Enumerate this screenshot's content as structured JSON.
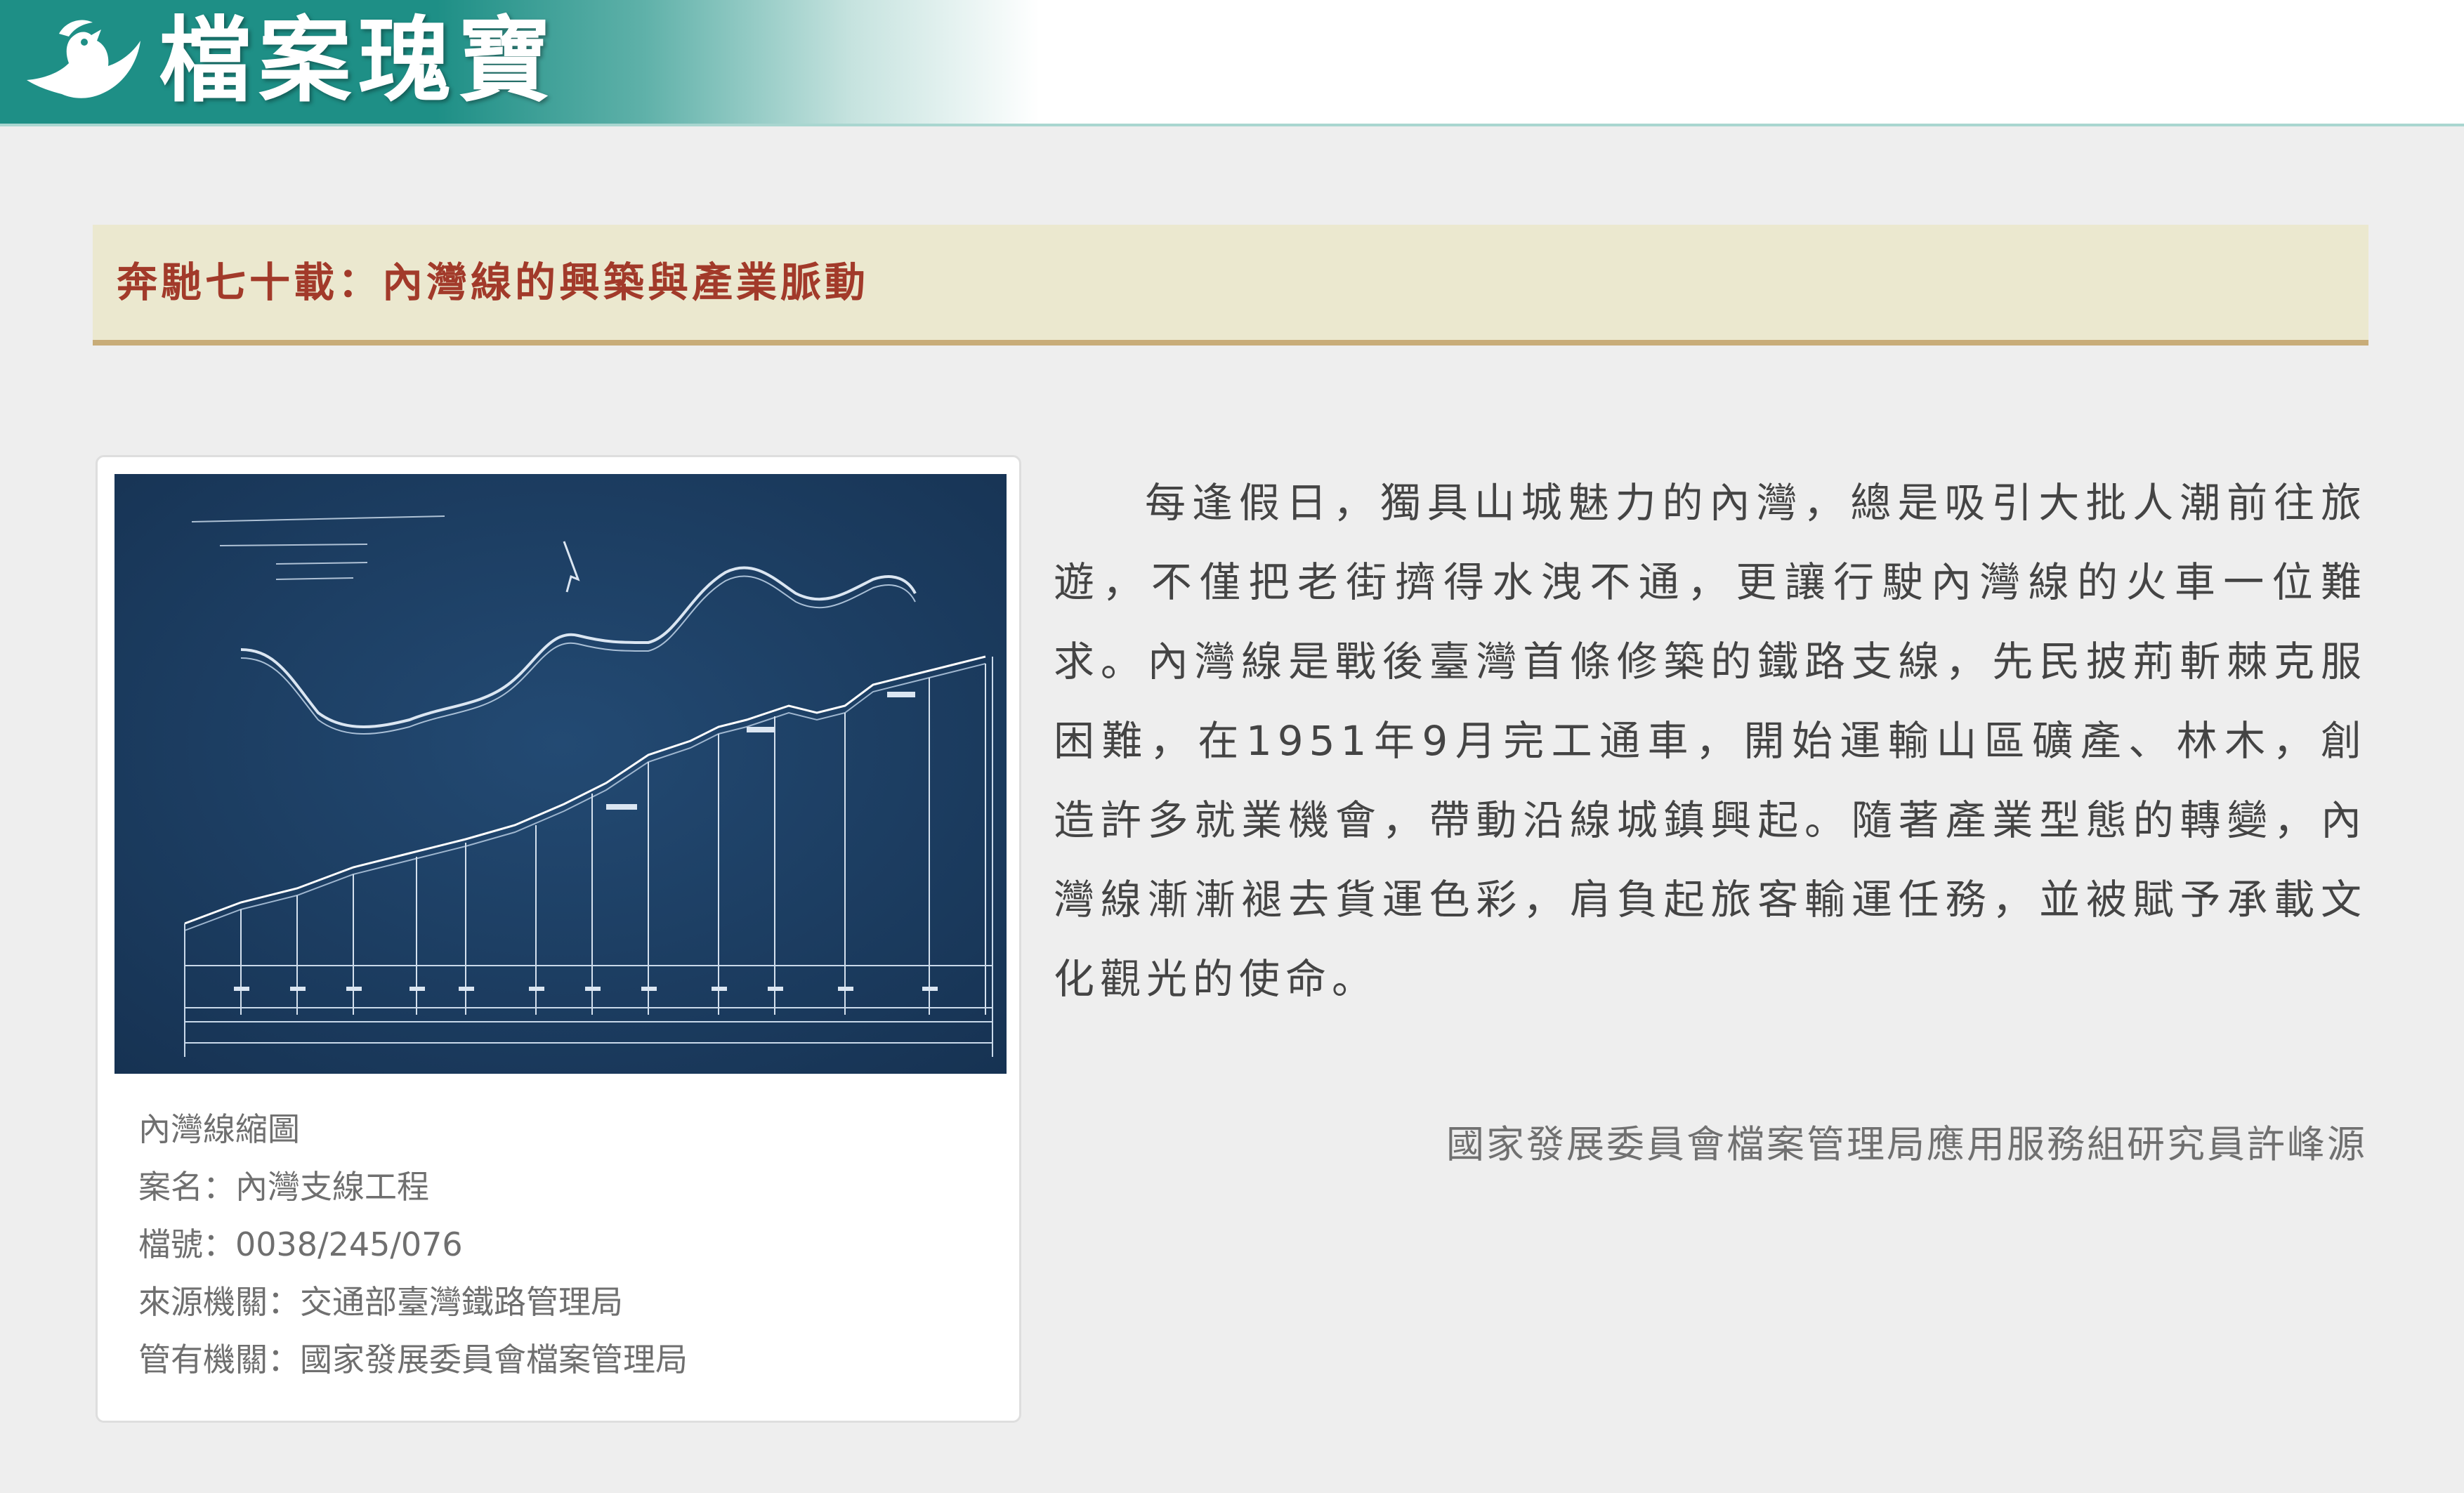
{
  "header": {
    "site_title": "檔案瑰寶",
    "logo_icon": "dove-icon",
    "banner_color": "#1e8f86"
  },
  "section": {
    "title": "奔馳七十載：內灣線的興築與產業脈動",
    "title_color": "#a23a2a",
    "background_color": "#ebe8cf"
  },
  "figure": {
    "image_description_icon": "blueprint-map-icon",
    "caption_title": "內灣線縮圖",
    "case_name": "案名：內灣支線工程",
    "file_number": "檔號：0038/245/076",
    "source_agency": "來源機關：交通部臺灣鐵路管理局",
    "custody_agency": "管有機關：國家發展委員會檔案管理局"
  },
  "article": {
    "body": "每逢假日，獨具山城魅力的內灣，總是吸引大批人潮前往旅遊，不僅把老街擠得水洩不通，更讓行駛內灣線的火車一位難求。內灣線是戰後臺灣首條修築的鐵路支線，先民披荊斬棘克服困難，在1951年9月完工通車，開始運輸山區礦產、林木，創造許多就業機會，帶動沿線城鎮興起。隨著產業型態的轉變，內灣線漸漸褪去貨運色彩，肩負起旅客輸運任務，並被賦予承載文化觀光的使命。",
    "author": "國家發展委員會檔案管理局應用服務組研究員許峰源"
  }
}
